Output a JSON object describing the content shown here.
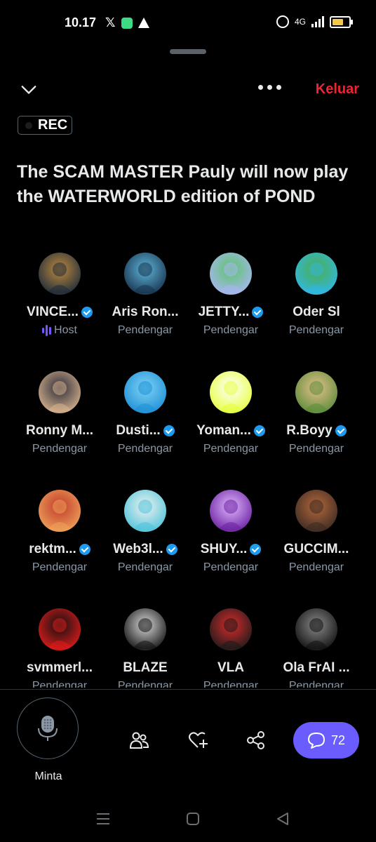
{
  "status_bar": {
    "time": "10.17",
    "x_icon": "x-logo",
    "network": "4G"
  },
  "header": {
    "collapse_icon": "chevron-down-icon",
    "more_icon": "more-icon",
    "leave_label": "Keluar"
  },
  "rec": {
    "label": "REC"
  },
  "space": {
    "title": "The SCAM MASTER Pauly will now play the WATERWORLD edition of POND"
  },
  "participants": [
    {
      "name": "VINCE...",
      "role": "Host",
      "verified": true,
      "avatar_colors": [
        "#1b2a3a",
        "#c08a3e"
      ]
    },
    {
      "name": "Aris Ron...",
      "role": "Pendengar",
      "verified": false,
      "avatar_colors": [
        "#17314d",
        "#5fb6d8"
      ]
    },
    {
      "name": "JETTY...",
      "role": "Pendengar",
      "verified": true,
      "avatar_colors": [
        "#a9b6f5",
        "#5cc46a"
      ]
    },
    {
      "name": "Oder Sl",
      "role": "Pendengar",
      "verified": false,
      "avatar_colors": [
        "#2fb7e8",
        "#4cae4a"
      ]
    },
    {
      "name": "Ronny M...",
      "role": "Pendengar",
      "verified": false,
      "avatar_colors": [
        "#d9b48e",
        "#2b2b3a"
      ]
    },
    {
      "name": "Dusti...",
      "role": "Pendengar",
      "verified": true,
      "avatar_colors": [
        "#1e8fd6",
        "#7fd3f5"
      ]
    },
    {
      "name": "Yoman...",
      "role": "Pendengar",
      "verified": true,
      "avatar_colors": [
        "#e6ff3a",
        "#ffffff"
      ]
    },
    {
      "name": "R.Boyy",
      "role": "Pendengar",
      "verified": true,
      "avatar_colors": [
        "#5a8c3a",
        "#e6c08a"
      ]
    },
    {
      "name": "rektm...",
      "role": "Pendengar",
      "verified": true,
      "avatar_colors": [
        "#f0a35a",
        "#c0392b"
      ]
    },
    {
      "name": "Web3l...",
      "role": "Pendengar",
      "verified": true,
      "avatar_colors": [
        "#4dc3d9",
        "#f1f1f1"
      ]
    },
    {
      "name": "SHUY...",
      "role": "Pendengar",
      "verified": true,
      "avatar_colors": [
        "#6a1fa0",
        "#e0b8ff"
      ]
    },
    {
      "name": "GUCCIM...",
      "role": "Pendengar",
      "verified": false,
      "avatar_colors": [
        "#3a2a22",
        "#b5683c"
      ]
    },
    {
      "name": "svmmerl...",
      "role": "Pendengar",
      "verified": false,
      "avatar_colors": [
        "#e01b1b",
        "#111111"
      ]
    },
    {
      "name": "BLAZE",
      "role": "Pendengar",
      "verified": false,
      "avatar_colors": [
        "#111111",
        "#d9d9d9"
      ]
    },
    {
      "name": "VLA",
      "role": "Pendengar",
      "verified": false,
      "avatar_colors": [
        "#1a1a1a",
        "#d92b2b"
      ]
    },
    {
      "name": "Ola FrAI ...",
      "role": "Pendengar",
      "verified": false,
      "avatar_colors": [
        "#0f0f0f",
        "#8a8a8a"
      ]
    }
  ],
  "bottom_bar": {
    "request_label": "Minta",
    "mic_icon": "microphone-icon",
    "people_icon": "people-icon",
    "heart_icon": "heart-add-icon",
    "share_icon": "share-icon",
    "comment_icon": "comment-icon",
    "comment_count": "72"
  },
  "colors": {
    "accent": "#6a5cff",
    "leave": "#f4212e",
    "verified": "#1d9bf0",
    "host": "#7856ff"
  }
}
